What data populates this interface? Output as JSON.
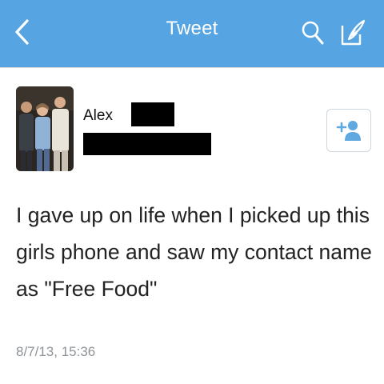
{
  "navbar": {
    "title": "Tweet",
    "back_icon": "chevron-left-icon",
    "search_icon": "search-icon",
    "compose_icon": "compose-icon",
    "background_color": "#56a5e2"
  },
  "tweet": {
    "author_name": "Alex",
    "follow_icon": "add-user-icon",
    "text": "I gave up on life when I picked up this girls phone and saw my contact name as \"Free Food\"",
    "timestamp": "8/7/13, 15:36"
  }
}
